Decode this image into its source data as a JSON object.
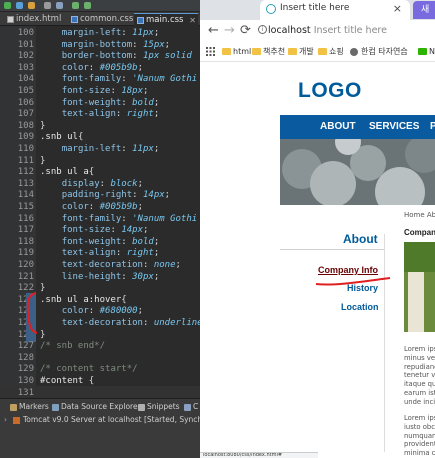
{
  "ide": {
    "tabs": [
      {
        "label": "index.html",
        "active": false
      },
      {
        "label": "common.css",
        "active": false
      },
      {
        "label": "main.css",
        "active": true
      }
    ],
    "lines": [
      {
        "n": "100",
        "tokens": [
          [
            "    ",
            "pun"
          ],
          [
            "margin-left",
            "prop"
          ],
          [
            ": ",
            "pun"
          ],
          [
            "11px",
            "val"
          ],
          [
            ";",
            "pun"
          ]
        ]
      },
      {
        "n": "101",
        "tokens": [
          [
            "    ",
            "pun"
          ],
          [
            "margin-bottom",
            "prop"
          ],
          [
            ": ",
            "pun"
          ],
          [
            "15px",
            "val"
          ],
          [
            ";",
            "pun"
          ]
        ]
      },
      {
        "n": "102",
        "tokens": [
          [
            "    ",
            "pun"
          ],
          [
            "border-bottom",
            "prop"
          ],
          [
            ": ",
            "pun"
          ],
          [
            "1px solid",
            "val"
          ]
        ]
      },
      {
        "n": "103",
        "tokens": [
          [
            "    ",
            "pun"
          ],
          [
            "color",
            "prop"
          ],
          [
            ": ",
            "pun"
          ],
          [
            "#005b9b",
            "val"
          ],
          [
            ";",
            "pun"
          ]
        ]
      },
      {
        "n": "104",
        "tokens": [
          [
            "    ",
            "pun"
          ],
          [
            "font-family",
            "prop"
          ],
          [
            ": ",
            "pun"
          ],
          [
            "'Nanum Gothi",
            "val"
          ]
        ]
      },
      {
        "n": "105",
        "tokens": [
          [
            "    ",
            "pun"
          ],
          [
            "font-size",
            "prop"
          ],
          [
            ": ",
            "pun"
          ],
          [
            "18px",
            "val"
          ],
          [
            ";",
            "pun"
          ]
        ]
      },
      {
        "n": "106",
        "tokens": [
          [
            "    ",
            "pun"
          ],
          [
            "font-weight",
            "prop"
          ],
          [
            ": ",
            "pun"
          ],
          [
            "bold",
            "val"
          ],
          [
            ";",
            "pun"
          ]
        ]
      },
      {
        "n": "107",
        "tokens": [
          [
            "    ",
            "pun"
          ],
          [
            "text-align",
            "prop"
          ],
          [
            ": ",
            "pun"
          ],
          [
            "right",
            "val"
          ],
          [
            ";",
            "pun"
          ]
        ]
      },
      {
        "n": "108",
        "tokens": [
          [
            "}",
            "brace"
          ]
        ]
      },
      {
        "n": "109",
        "tokens": [
          [
            ".snb ul",
            "sel"
          ],
          [
            "{",
            "brace"
          ]
        ]
      },
      {
        "n": "110",
        "tokens": [
          [
            "    ",
            "pun"
          ],
          [
            "margin-left",
            "prop"
          ],
          [
            ": ",
            "pun"
          ],
          [
            "11px",
            "val"
          ],
          [
            ";",
            "pun"
          ]
        ]
      },
      {
        "n": "111",
        "tokens": [
          [
            "}",
            "brace"
          ]
        ]
      },
      {
        "n": "112",
        "tokens": [
          [
            ".snb ul a",
            "sel"
          ],
          [
            "{",
            "brace"
          ]
        ]
      },
      {
        "n": "113",
        "tokens": [
          [
            "    ",
            "pun"
          ],
          [
            "display",
            "prop"
          ],
          [
            ": ",
            "pun"
          ],
          [
            "block",
            "val"
          ],
          [
            ";",
            "pun"
          ]
        ]
      },
      {
        "n": "114",
        "tokens": [
          [
            "    ",
            "pun"
          ],
          [
            "padding-right",
            "prop"
          ],
          [
            ": ",
            "pun"
          ],
          [
            "14px",
            "val"
          ],
          [
            ";",
            "pun"
          ]
        ]
      },
      {
        "n": "115",
        "tokens": [
          [
            "    ",
            "pun"
          ],
          [
            "color",
            "prop"
          ],
          [
            ": ",
            "pun"
          ],
          [
            "#005b9b",
            "val"
          ],
          [
            ";",
            "pun"
          ]
        ]
      },
      {
        "n": "116",
        "tokens": [
          [
            "    ",
            "pun"
          ],
          [
            "font-family",
            "prop"
          ],
          [
            ": ",
            "pun"
          ],
          [
            "'Nanum Gothi",
            "val"
          ]
        ]
      },
      {
        "n": "117",
        "tokens": [
          [
            "    ",
            "pun"
          ],
          [
            "font-size",
            "prop"
          ],
          [
            ": ",
            "pun"
          ],
          [
            "14px",
            "val"
          ],
          [
            ";",
            "pun"
          ]
        ]
      },
      {
        "n": "118",
        "tokens": [
          [
            "    ",
            "pun"
          ],
          [
            "font-weight",
            "prop"
          ],
          [
            ": ",
            "pun"
          ],
          [
            "bold",
            "val"
          ],
          [
            ";",
            "pun"
          ]
        ]
      },
      {
        "n": "119",
        "tokens": [
          [
            "    ",
            "pun"
          ],
          [
            "text-align",
            "prop"
          ],
          [
            ": ",
            "pun"
          ],
          [
            "right",
            "val"
          ],
          [
            ";",
            "pun"
          ]
        ]
      },
      {
        "n": "120",
        "tokens": [
          [
            "    ",
            "pun"
          ],
          [
            "text-decoration",
            "prop"
          ],
          [
            ": ",
            "pun"
          ],
          [
            "none",
            "val"
          ],
          [
            ";",
            "pun"
          ]
        ]
      },
      {
        "n": "121",
        "tokens": [
          [
            "    ",
            "pun"
          ],
          [
            "line-height",
            "prop"
          ],
          [
            ": ",
            "pun"
          ],
          [
            "30px",
            "val"
          ],
          [
            ";",
            "pun"
          ]
        ]
      },
      {
        "n": "122",
        "tokens": [
          [
            "}",
            "brace"
          ]
        ]
      },
      {
        "n": "123",
        "tokens": [
          [
            ".snb ul a:hover",
            "sel"
          ],
          [
            "{",
            "brace"
          ]
        ]
      },
      {
        "n": "124",
        "tokens": [
          [
            "    ",
            "pun"
          ],
          [
            "color",
            "prop"
          ],
          [
            ": ",
            "pun"
          ],
          [
            "#680000",
            "val"
          ],
          [
            ";",
            "pun"
          ]
        ]
      },
      {
        "n": "125",
        "tokens": [
          [
            "    ",
            "pun"
          ],
          [
            "text-decoration",
            "prop"
          ],
          [
            ": ",
            "pun"
          ],
          [
            "underline",
            "val"
          ]
        ]
      },
      {
        "n": "126",
        "tokens": [
          [
            "}",
            "brace"
          ]
        ]
      },
      {
        "n": "127",
        "tokens": [
          [
            "/* snb end*/",
            "com"
          ]
        ]
      },
      {
        "n": "128",
        "tokens": [
          [
            "",
            "pun"
          ]
        ]
      },
      {
        "n": "129",
        "tokens": [
          [
            "/* content start*/",
            "com"
          ]
        ]
      },
      {
        "n": "130",
        "tokens": [
          [
            "#content",
            "sel"
          ],
          [
            " {",
            "brace"
          ]
        ]
      },
      {
        "n": "131",
        "tokens": [
          [
            "    ",
            "pun"
          ]
        ]
      }
    ],
    "bottom_tabs": [
      "Markers",
      "Data Source Explorer",
      "Snippets",
      "C"
    ],
    "server_row": "Tomcat v9.0 Server at localhost  [Started, Synchro"
  },
  "browser": {
    "tab_title": "Insert title here",
    "new_tab_label": "새",
    "url_host": "localhost",
    "url_rest": "Insert title here",
    "bookmarks": [
      "html",
      "책추천",
      "개발",
      "쇼핑",
      "한컴 타자연습",
      "N"
    ],
    "page": {
      "logo": "LOGO",
      "gnb": [
        "ABOUT",
        "SERVICES",
        "P"
      ],
      "snb_title": "About",
      "snb_links": [
        {
          "label": "Company Info",
          "color": "#680000"
        },
        {
          "label": "History",
          "color": "#005b9b"
        },
        {
          "label": "Location",
          "color": "#005b9b"
        }
      ],
      "breadcrumb": "Home Abo",
      "content_title": "Compan",
      "lorem_1": "Lorem ips\nminus ve\nrepudianc\ntenetur ve\nitaque qu\nearum ist\nunde inci",
      "lorem_2": "Lorem ips\niusto obc\nnumquam\nprovident\nminima co"
    },
    "status": "localhost:8080/css/index.html#"
  },
  "colors": {
    "accent": "#005b9b",
    "hover": "#680000",
    "annotation": "#e02020"
  }
}
